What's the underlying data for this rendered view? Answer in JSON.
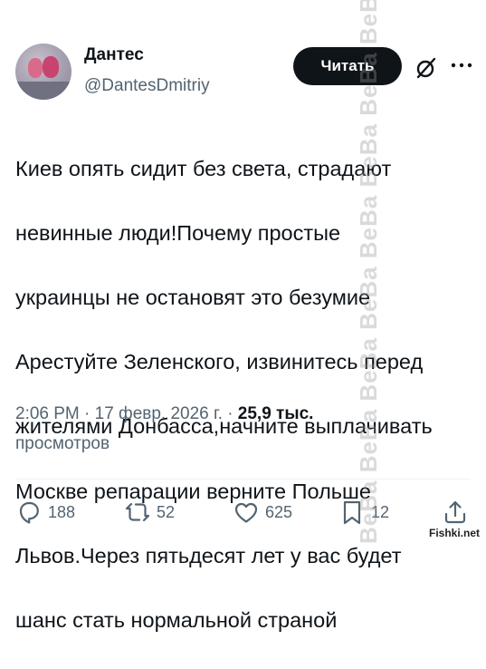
{
  "author": {
    "name": "Дантес",
    "handle": "@DantesDmitriy"
  },
  "header": {
    "read_button_label": "Читать"
  },
  "tweet": {
    "text_lines": [
      "Киев опять сидит без света, страдают",
      "невинные люди!Почему простые",
      "украинцы не остановят это безумие",
      "Арестуйте Зеленского, извинитесь перед",
      "жителями Донбасса,начните выплачивать",
      "Москве репарации верните Польше",
      "Львов.Через пятьдесят лет у вас будет",
      "шанс стать нормальной страной"
    ],
    "time_date": "2:06 PM · 17 февр. 2026 г. · ",
    "views_count": "25,9 тыс.",
    "views_label": "просмотров"
  },
  "actions": {
    "replies": "188",
    "reposts": "52",
    "likes": "625",
    "bookmarks": "12"
  },
  "icons": {
    "reply": "reply-icon",
    "repost": "repost-icon",
    "like": "heart-icon",
    "bookmark": "bookmark-icon",
    "share": "share-icon",
    "grok": "grok-icon",
    "more": "more-icon"
  },
  "overlay": {
    "watermark": "BeBa BeBa BeBa BeBa BeBa BeBa BeBa BeBa BeBa",
    "site": "Fishki.net"
  },
  "colors": {
    "text": "#0f1419",
    "secondary": "#536471",
    "button_bg": "#0f1419",
    "button_text": "#ffffff"
  }
}
